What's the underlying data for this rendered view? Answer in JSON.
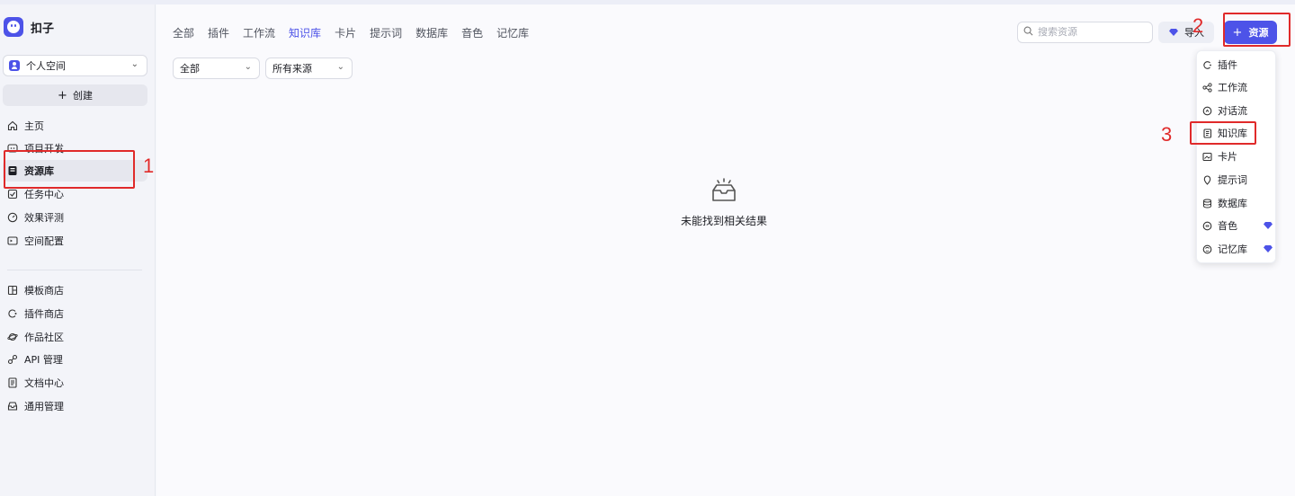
{
  "app": {
    "name": "扣子"
  },
  "space": {
    "label": "个人空间"
  },
  "create_label": "创建",
  "sidebar": {
    "items": [
      {
        "label": "主页",
        "icon": "home-icon"
      },
      {
        "label": "项目开发",
        "icon": "project-icon"
      },
      {
        "label": "资源库",
        "icon": "library-icon",
        "active": true
      },
      {
        "label": "任务中心",
        "icon": "task-icon"
      },
      {
        "label": "效果评测",
        "icon": "evaluation-icon"
      },
      {
        "label": "空间配置",
        "icon": "config-icon"
      }
    ],
    "items2": [
      {
        "label": "模板商店",
        "icon": "template-icon"
      },
      {
        "label": "插件商店",
        "icon": "plugin-store-icon"
      },
      {
        "label": "作品社区",
        "icon": "community-icon"
      },
      {
        "label": "API 管理",
        "icon": "api-icon"
      },
      {
        "label": "文档中心",
        "icon": "doc-icon"
      },
      {
        "label": "通用管理",
        "icon": "manage-icon"
      }
    ]
  },
  "tabs": [
    "全部",
    "插件",
    "工作流",
    "知识库",
    "卡片",
    "提示词",
    "数据库",
    "音色",
    "记忆库"
  ],
  "active_tab": "知识库",
  "filters": {
    "type": "全部",
    "source": "所有来源"
  },
  "search": {
    "placeholder": "搜索资源",
    "value": ""
  },
  "import_label": "导入",
  "resource_button_label": "资源",
  "empty_text": "未能找到相关结果",
  "dropdown": {
    "items": [
      {
        "label": "插件",
        "icon": "plugin-icon"
      },
      {
        "label": "工作流",
        "icon": "workflow-icon"
      },
      {
        "label": "对话流",
        "icon": "chatflow-icon"
      },
      {
        "label": "知识库",
        "icon": "knowledge-icon"
      },
      {
        "label": "卡片",
        "icon": "card-icon"
      },
      {
        "label": "提示词",
        "icon": "prompt-icon"
      },
      {
        "label": "数据库",
        "icon": "database-icon"
      },
      {
        "label": "音色",
        "icon": "voice-icon",
        "premium": true
      },
      {
        "label": "记忆库",
        "icon": "memory-icon",
        "premium": true
      }
    ]
  },
  "annotations": [
    "1",
    "2",
    "3"
  ],
  "colors": {
    "accent": "#4d53e8",
    "annotation": "#e02a2a",
    "premium": "#4d53e8"
  }
}
